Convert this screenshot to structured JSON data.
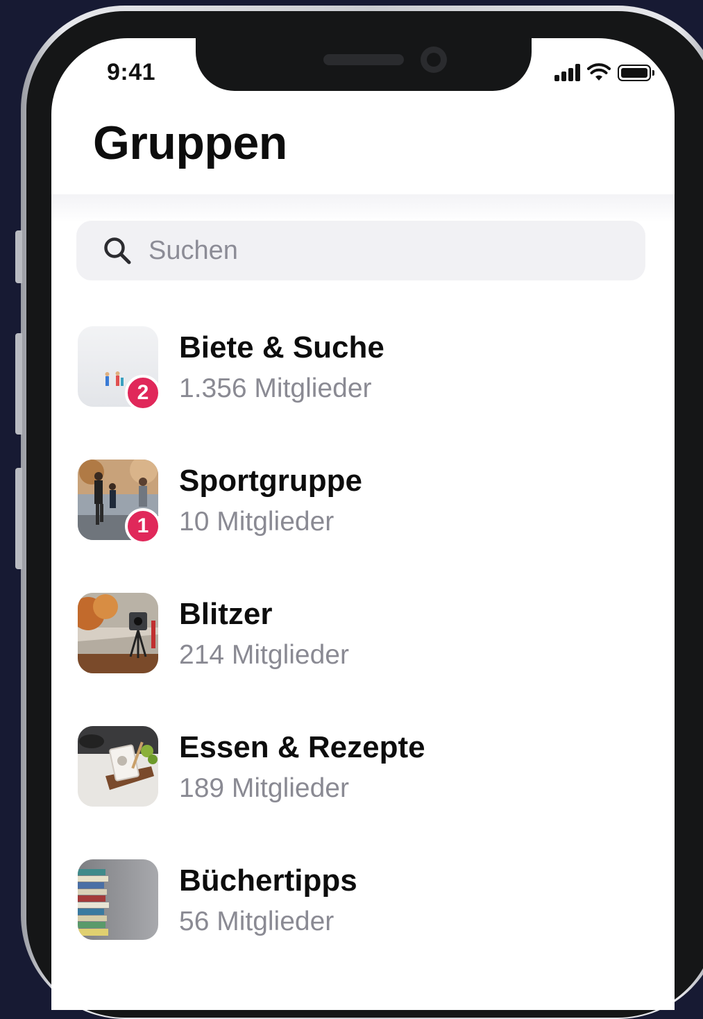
{
  "status_bar": {
    "time": "9:41"
  },
  "header": {
    "title": "Gruppen"
  },
  "search": {
    "placeholder": "Suchen",
    "icon": "search-icon"
  },
  "groups": [
    {
      "name": "Biete & Suche",
      "members": "1.356 Mitglieder",
      "badge": "2"
    },
    {
      "name": "Sportgruppe",
      "members": "10 Mitglieder",
      "badge": "1"
    },
    {
      "name": "Blitzer",
      "members": "214 Mitglieder",
      "badge": null
    },
    {
      "name": "Essen & Rezepte",
      "members": "189 Mitglieder",
      "badge": null
    },
    {
      "name": "Büchertipps",
      "members": "56 Mitglieder",
      "badge": null
    }
  ],
  "colors": {
    "badge": "#e0285a",
    "background": "#171a33",
    "muted_text": "#8a8a93"
  }
}
